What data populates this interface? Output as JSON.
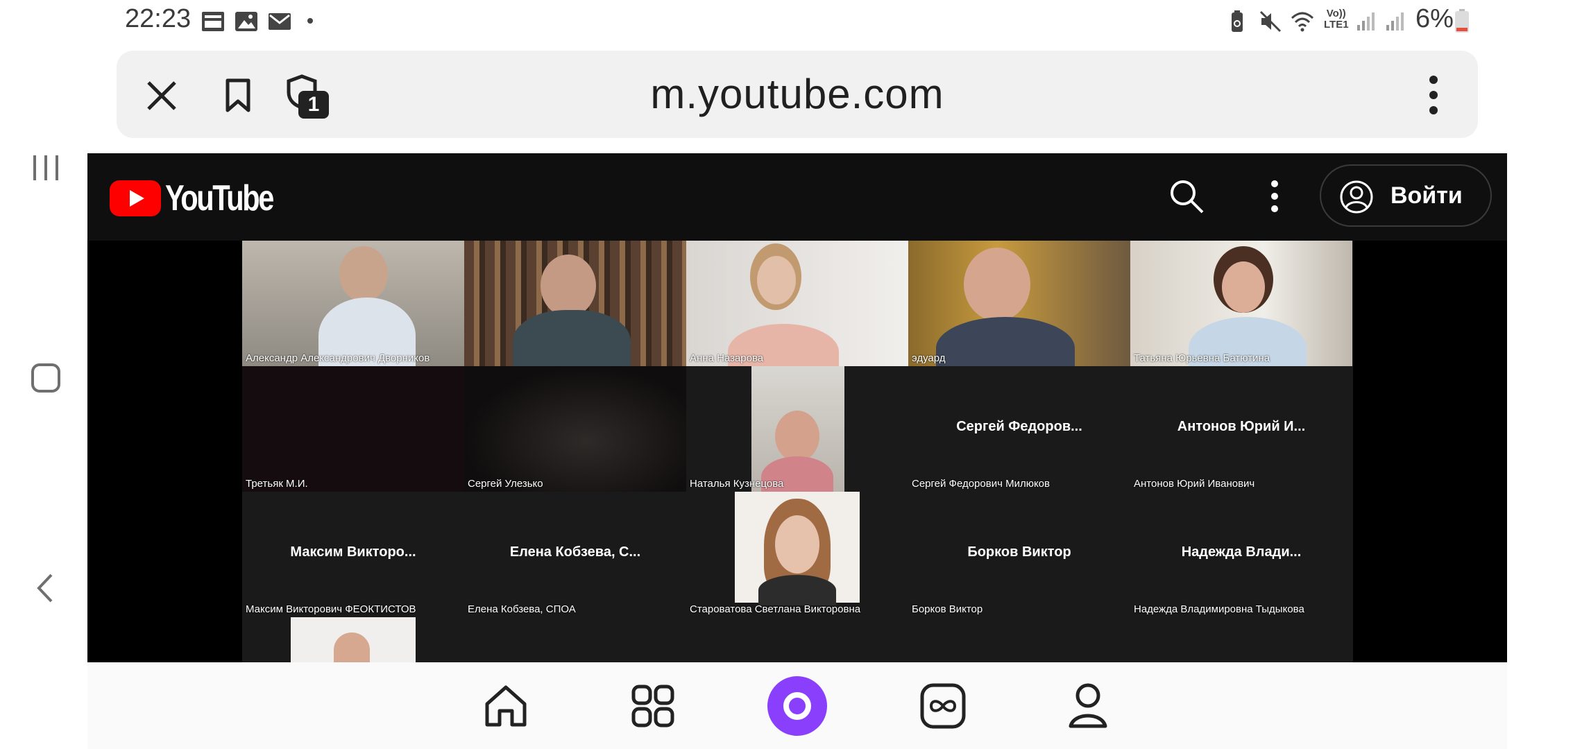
{
  "status_bar": {
    "time": "22:23",
    "battery_percent": "6%",
    "network_label_top": "Vo))",
    "network_label_bottom": "LTE1",
    "left_icons": [
      "mail-outline-icon",
      "image-icon",
      "mail-icon",
      "dot-icon"
    ],
    "right_icons": [
      "battery-saver-icon",
      "mute-icon",
      "wifi-icon",
      "signal-icon",
      "signal-icon",
      "battery-icon"
    ]
  },
  "browser": {
    "url": "m.youtube.com",
    "tab_count": "1"
  },
  "youtube": {
    "logo_text": "YouTube",
    "sign_in_label": "Войти"
  },
  "video_tiles": [
    {
      "name": "Александр Александрович Дворников",
      "center_label": ""
    },
    {
      "name": "",
      "center_label": ""
    },
    {
      "name": "Анна Назарова",
      "center_label": ""
    },
    {
      "name": "эдуард",
      "center_label": ""
    },
    {
      "name": "Татьяна Юрьевна Батютина",
      "center_label": ""
    },
    {
      "name": "Третьяк М.И.",
      "center_label": ""
    },
    {
      "name": "Сергей Улезько",
      "center_label": ""
    },
    {
      "name": "Наталья Кузнецова",
      "center_label": ""
    },
    {
      "name": "Сергей Федорович Милюков",
      "center_label": "Сергей Федоров..."
    },
    {
      "name": "Антонов Юрий Иванович",
      "center_label": "Антонов Юрий И..."
    },
    {
      "name": "Максим Викторович ФЕОКТИСТОВ",
      "center_label": "Максим Викторо..."
    },
    {
      "name": "Елена Кобзева, СПОА",
      "center_label": "Елена Кобзева, С..."
    },
    {
      "name": "Староватова Светлана Викторовна",
      "center_label": ""
    },
    {
      "name": "Борков Виктор",
      "center_label": "Борков Виктор"
    },
    {
      "name": "Надежда Владимировна Тыдыкова",
      "center_label": "Надежда Влади..."
    }
  ],
  "bottom_nav": {
    "items": [
      "home-icon",
      "apps-grid-icon",
      "alice-assistant-icon",
      "infinity-icon",
      "profile-icon"
    ],
    "accent_color": "#8a3ffc"
  },
  "colors": {
    "youtube_red": "#ff0000",
    "header_bg": "#0f0f0f",
    "grid_bg": "#1a1a1a"
  }
}
